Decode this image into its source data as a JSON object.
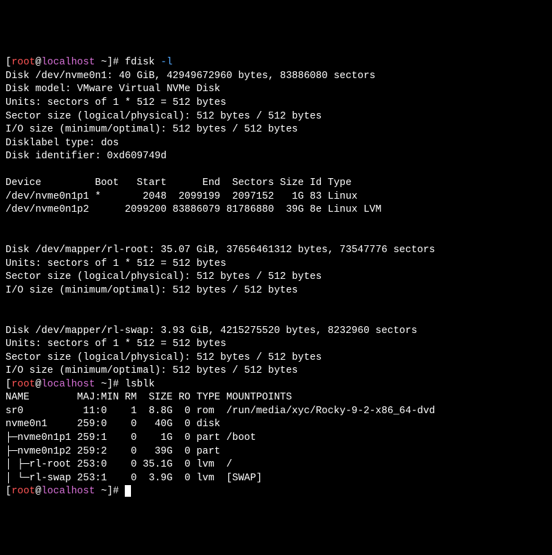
{
  "prompt1": {
    "open": "[",
    "user": "root",
    "at": "@",
    "host": "localhost",
    "pathsep": " ",
    "path": "~",
    "close": "]#",
    "cmd": "fdisk",
    "arg": "-l"
  },
  "disk1": {
    "l1": "Disk /dev/nvme0n1: 40 GiB, 42949672960 bytes, 83886080 sectors",
    "l2": "Disk model: VMware Virtual NVMe Disk",
    "l3": "Units: sectors of 1 * 512 = 512 bytes",
    "l4": "Sector size (logical/physical): 512 bytes / 512 bytes",
    "l5": "I/O size (minimum/optimal): 512 bytes / 512 bytes",
    "l6": "Disklabel type: dos",
    "l7": "Disk identifier: 0xd609749d"
  },
  "parttable": {
    "header": "Device         Boot   Start      End  Sectors Size Id Type",
    "r1": "/dev/nvme0n1p1 *       2048  2099199  2097152   1G 83 Linux",
    "r2": "/dev/nvme0n1p2      2099200 83886079 81786880  39G 8e Linux LVM"
  },
  "disk2": {
    "l1": "Disk /dev/mapper/rl-root: 35.07 GiB, 37656461312 bytes, 73547776 sectors",
    "l2": "Units: sectors of 1 * 512 = 512 bytes",
    "l3": "Sector size (logical/physical): 512 bytes / 512 bytes",
    "l4": "I/O size (minimum/optimal): 512 bytes / 512 bytes"
  },
  "disk3": {
    "l1": "Disk /dev/mapper/rl-swap: 3.93 GiB, 4215275520 bytes, 8232960 sectors",
    "l2": "Units: sectors of 1 * 512 = 512 bytes",
    "l3": "Sector size (logical/physical): 512 bytes / 512 bytes",
    "l4": "I/O size (minimum/optimal): 512 bytes / 512 bytes"
  },
  "prompt2": {
    "open": "[",
    "user": "root",
    "at": "@",
    "host": "localhost",
    "pathsep": " ",
    "path": "~",
    "close": "]#",
    "cmd": "lsblk"
  },
  "lsblk": {
    "header": "NAME        MAJ:MIN RM  SIZE RO TYPE MOUNTPOINTS",
    "r1": "sr0          11:0    1  8.8G  0 rom  /run/media/xyc/Rocky-9-2-x86_64-dvd",
    "r2": "nvme0n1     259:0    0   40G  0 disk",
    "r3": "├─nvme0n1p1 259:1    0    1G  0 part /boot",
    "r4": "├─nvme0n1p2 259:2    0   39G  0 part",
    "r5": "│ ├─rl-root 253:0    0 35.1G  0 lvm  /",
    "r6": "│ └─rl-swap 253:1    0  3.9G  0 lvm  [SWAP]"
  },
  "prompt3": {
    "open": "[",
    "user": "root",
    "at": "@",
    "host": "localhost",
    "pathsep": " ",
    "path": "~",
    "close": "]#"
  }
}
